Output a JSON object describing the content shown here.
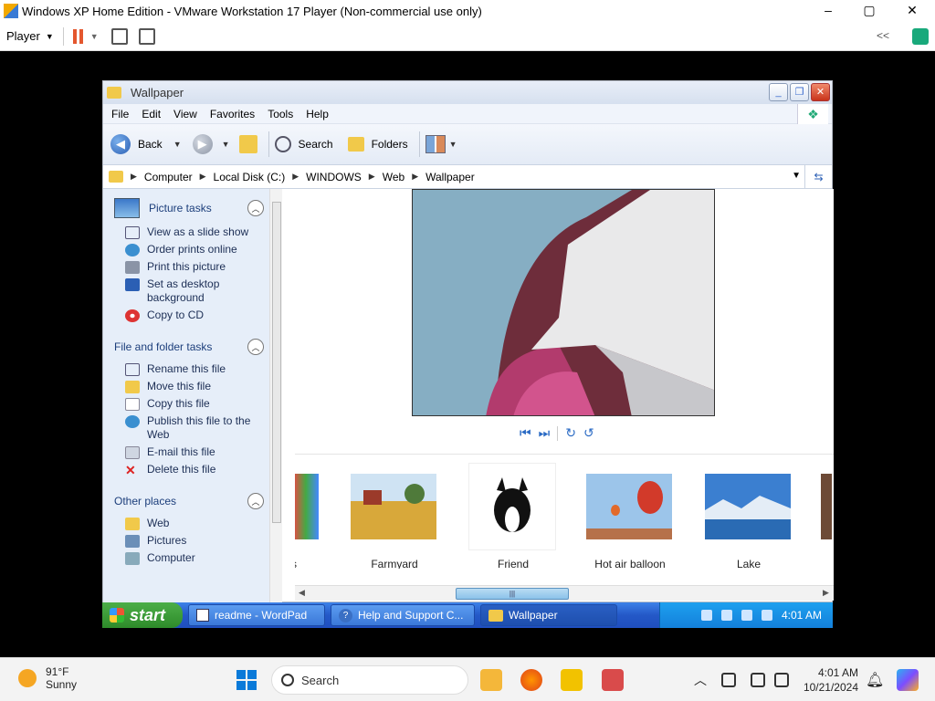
{
  "vmware": {
    "title": "Windows XP Home Edition - VMware Workstation 17 Player (Non-commercial use only)",
    "player_label": "Player",
    "controls": {
      "minimize": "–",
      "maximize": "▢",
      "close": "✕"
    },
    "collapse": "<<"
  },
  "explorer": {
    "title": "Wallpaper",
    "menu": [
      "File",
      "Edit",
      "View",
      "Favorites",
      "Tools",
      "Help"
    ],
    "toolbar": {
      "back": "Back",
      "search": "Search",
      "folders": "Folders"
    },
    "address": [
      "Computer",
      "Local Disk (C:)",
      "WINDOWS",
      "Web",
      "Wallpaper"
    ],
    "tasks": {
      "picture": {
        "title": "Picture tasks",
        "items": [
          "View as a slide show",
          "Order prints online",
          "Print this picture",
          "Set as desktop background",
          "Copy to CD"
        ]
      },
      "file": {
        "title": "File and folder tasks",
        "items": [
          "Rename this file",
          "Move this file",
          "Copy this file",
          "Publish this file to the Web",
          "E-mail this file",
          "Delete this file"
        ]
      },
      "other": {
        "title": "Other places",
        "items": [
          "Web",
          "Pictures",
          "Computer"
        ]
      }
    },
    "thumbnails": [
      "s",
      "Farmyard",
      "Friend",
      "Hot air balloon",
      "Lake"
    ]
  },
  "xp_taskbar": {
    "start": "start",
    "windows": [
      "readme - WordPad",
      "Help and Support C...",
      "Wallpaper"
    ],
    "time": "4:01 AM"
  },
  "host": {
    "weather_temp": "91°F",
    "weather_desc": "Sunny",
    "search": "Search",
    "time": "4:01 AM",
    "date": "10/21/2024"
  }
}
